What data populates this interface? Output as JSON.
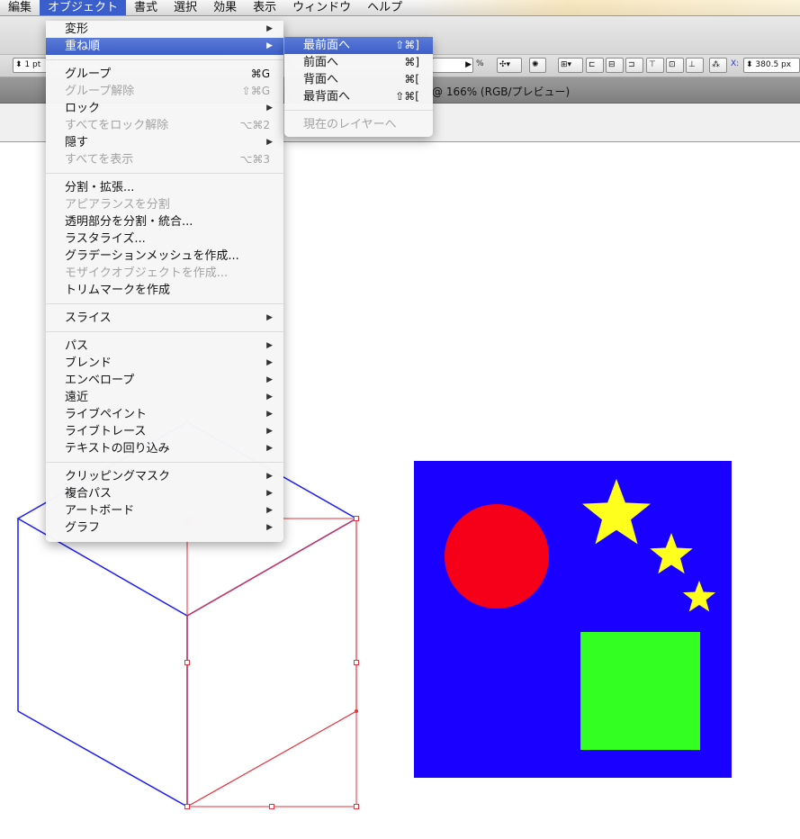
{
  "menubar": {
    "items": [
      "編集",
      "オブジェクト",
      "書式",
      "選択",
      "効果",
      "表示",
      "ウィンドウ",
      "ヘルプ"
    ]
  },
  "controlbar": {
    "stroke_value": "1 pt",
    "percent_label": "%",
    "x_label": "X:",
    "x_value": "380.5 px"
  },
  "document": {
    "title_fragment": "@ 166% (RGB/プレビュー)"
  },
  "object_menu": {
    "items": [
      {
        "label": "変形",
        "submenu": true
      },
      {
        "label": "重ね順",
        "submenu": true,
        "highlighted": true
      },
      {
        "separator": true
      },
      {
        "label": "グループ",
        "shortcut": "⌘G"
      },
      {
        "label": "グループ解除",
        "shortcut": "⇧⌘G",
        "disabled": true
      },
      {
        "label": "ロック",
        "submenu": true
      },
      {
        "label": "すべてをロック解除",
        "shortcut": "⌥⌘2",
        "disabled": true
      },
      {
        "label": "隠す",
        "submenu": true
      },
      {
        "label": "すべてを表示",
        "shortcut": "⌥⌘3",
        "disabled": true
      },
      {
        "separator": true
      },
      {
        "label": "分割・拡張..."
      },
      {
        "label": "アピアランスを分割",
        "disabled": true
      },
      {
        "label": "透明部分を分割・統合..."
      },
      {
        "label": "ラスタライズ..."
      },
      {
        "label": "グラデーションメッシュを作成..."
      },
      {
        "label": "モザイクオブジェクトを作成...",
        "disabled": true
      },
      {
        "label": "トリムマークを作成"
      },
      {
        "separator": true
      },
      {
        "label": "スライス",
        "submenu": true
      },
      {
        "separator": true
      },
      {
        "label": "パス",
        "submenu": true
      },
      {
        "label": "ブレンド",
        "submenu": true
      },
      {
        "label": "エンベロープ",
        "submenu": true
      },
      {
        "label": "遠近",
        "submenu": true
      },
      {
        "label": "ライブペイント",
        "submenu": true
      },
      {
        "label": "ライブトレース",
        "submenu": true
      },
      {
        "label": "テキストの回り込み",
        "submenu": true
      },
      {
        "separator": true
      },
      {
        "label": "クリッピングマスク",
        "submenu": true
      },
      {
        "label": "複合パス",
        "submenu": true
      },
      {
        "label": "アートボード",
        "submenu": true
      },
      {
        "label": "グラフ",
        "submenu": true
      }
    ]
  },
  "arrange_submenu": {
    "items": [
      {
        "label": "最前面へ",
        "shortcut": "⇧⌘]",
        "highlighted": true
      },
      {
        "label": "前面へ",
        "shortcut": "⌘]"
      },
      {
        "label": "背面へ",
        "shortcut": "⌘["
      },
      {
        "label": "最背面へ",
        "shortcut": "⇧⌘["
      },
      {
        "separator": true
      },
      {
        "label": "現在のレイヤーへ",
        "disabled": true
      }
    ]
  },
  "artwork": {
    "square_color": "#1a00ff",
    "circle_color": "#f50018",
    "rect_color": "#33ff22",
    "star_color": "#ffff1e",
    "cube_stroke": "#1c1cff",
    "selection_color": "#e8323c"
  }
}
